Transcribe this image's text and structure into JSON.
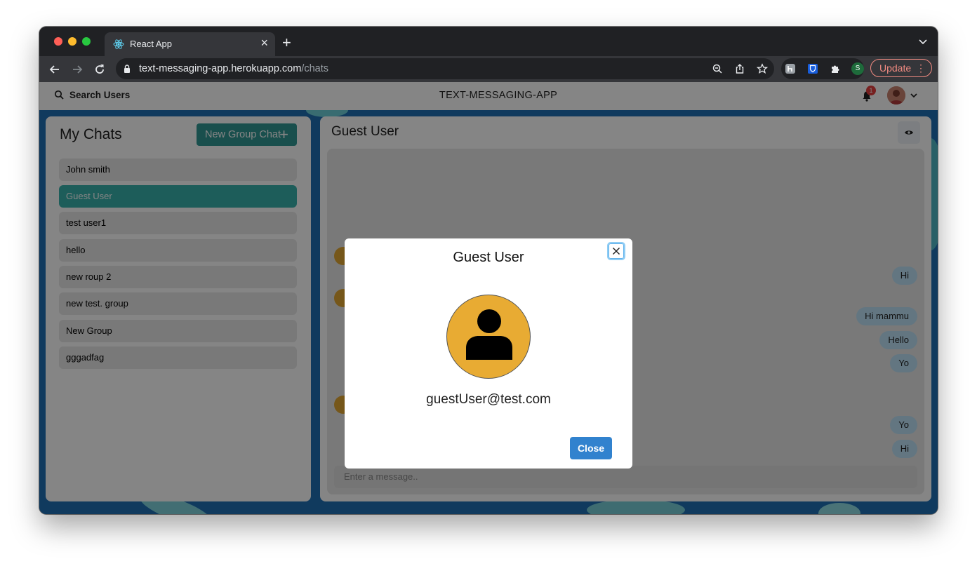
{
  "browser": {
    "tab_title": "React App",
    "url_host": "text-messaging-app.herokuapp.com",
    "url_path": "/chats",
    "update_label": "Update",
    "profile_initial": "S"
  },
  "header": {
    "search_label": "Search Users",
    "app_title": "TEXT-MESSAGING-APP",
    "notification_count": "1"
  },
  "sidebar": {
    "title": "My Chats",
    "new_group_label": "New Group Chat",
    "chats": [
      {
        "label": "John smith"
      },
      {
        "label": "Guest User"
      },
      {
        "label": "test user1"
      },
      {
        "label": "hello"
      },
      {
        "label": "new roup 2"
      },
      {
        "label": "new test. group"
      },
      {
        "label": "New Group"
      },
      {
        "label": "gggadfag"
      }
    ],
    "active_index": 1
  },
  "chat": {
    "title": "Guest User",
    "messages": [
      {
        "text": "Hi"
      },
      {
        "text": "Hi mammu"
      },
      {
        "text": "Hello"
      },
      {
        "text": "Yo"
      },
      {
        "text": "Yo"
      },
      {
        "text": "Hi"
      }
    ],
    "input_placeholder": "Enter a message.."
  },
  "modal": {
    "title": "Guest User",
    "email": "guestUser@test.com",
    "close_label": "Close"
  },
  "colors": {
    "teal_accent": "#319795",
    "modal_button": "#3182ce",
    "avatar_bg": "#e8ab33"
  }
}
